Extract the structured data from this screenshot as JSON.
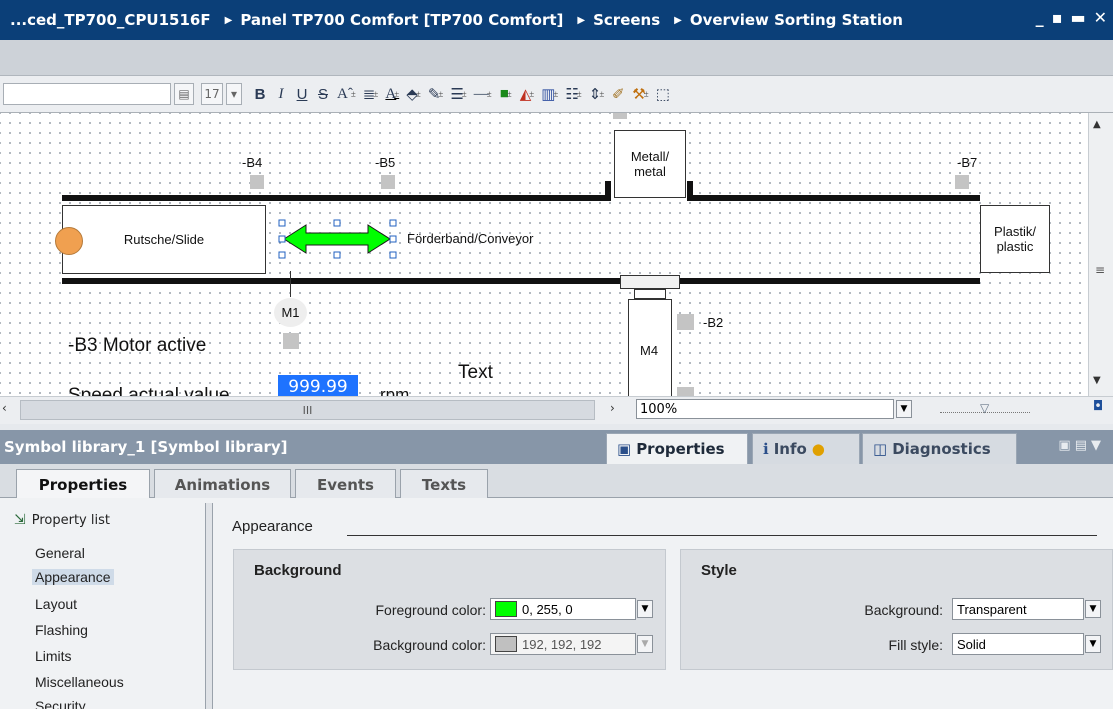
{
  "titlebar": {
    "crumbs": [
      "...ced_TP700_CPU1516F",
      "Panel TP700 Comfort [TP700 Comfort]",
      "Screens",
      "Overview Sorting Station"
    ],
    "separator": "▶",
    "win_controls": [
      "_",
      "▪",
      "▬",
      "✕"
    ]
  },
  "toolbar": {
    "font_size": "17",
    "bold": "B",
    "italic": "I",
    "underline": "U",
    "strike": "S",
    "icons": [
      "text-size-icon",
      "align-icon",
      "font-color-icon",
      "fill-color-icon",
      "line-color-icon",
      "line-style-icon",
      "line-width-icon",
      "fill-pattern-icon",
      "fill-tool-icon",
      "bar-chart-icon",
      "list-icon",
      "spacing-icon",
      "format-painter-icon",
      "format-tool-icon",
      "zoom-select-icon"
    ]
  },
  "canvas": {
    "labels": {
      "b4": "-B4",
      "b5": "-B5",
      "b7": "-B7",
      "b2": "-B2",
      "metal": "Metall/ metal",
      "slide": "Rutsche/Slide",
      "conveyor": "Förderband/Conveyor",
      "plastic": "Plastik/ plastic",
      "m1": "M1",
      "m4": "M4",
      "motor_active": "-B3 Motor active",
      "text": "Text",
      "speed": "Speed actual value",
      "speed_value": "999.99",
      "speed_unit": "rpm"
    },
    "colors": {
      "arrow": "#00ff00",
      "lamp": "#f0a050",
      "field": "#1e73ff"
    }
  },
  "hscroll": {
    "zoom": "100%",
    "thumb": "III"
  },
  "panel": {
    "title": "Symbol library_1 [Symbol library]",
    "tabs": [
      "Properties",
      "Info",
      "Diagnostics"
    ],
    "subtabs": [
      "Properties",
      "Animations",
      "Events",
      "Texts"
    ]
  },
  "properties": {
    "property_list": "Property list",
    "nav": [
      "General",
      "Appearance",
      "Layout",
      "Flashing",
      "Limits",
      "Miscellaneous",
      "Security"
    ],
    "section": "Appearance",
    "background_group": "Background",
    "fg_label": "Foreground color:",
    "fg_value": "0, 255, 0",
    "fg_color": "#00ff00",
    "bg_label": "Background color:",
    "bg_value": "192, 192, 192",
    "bg_color": "#c0c0c0",
    "style_group": "Style",
    "style_bg_label": "Background:",
    "style_bg_value": "Transparent",
    "fill_label": "Fill style:",
    "fill_value": "Solid"
  }
}
